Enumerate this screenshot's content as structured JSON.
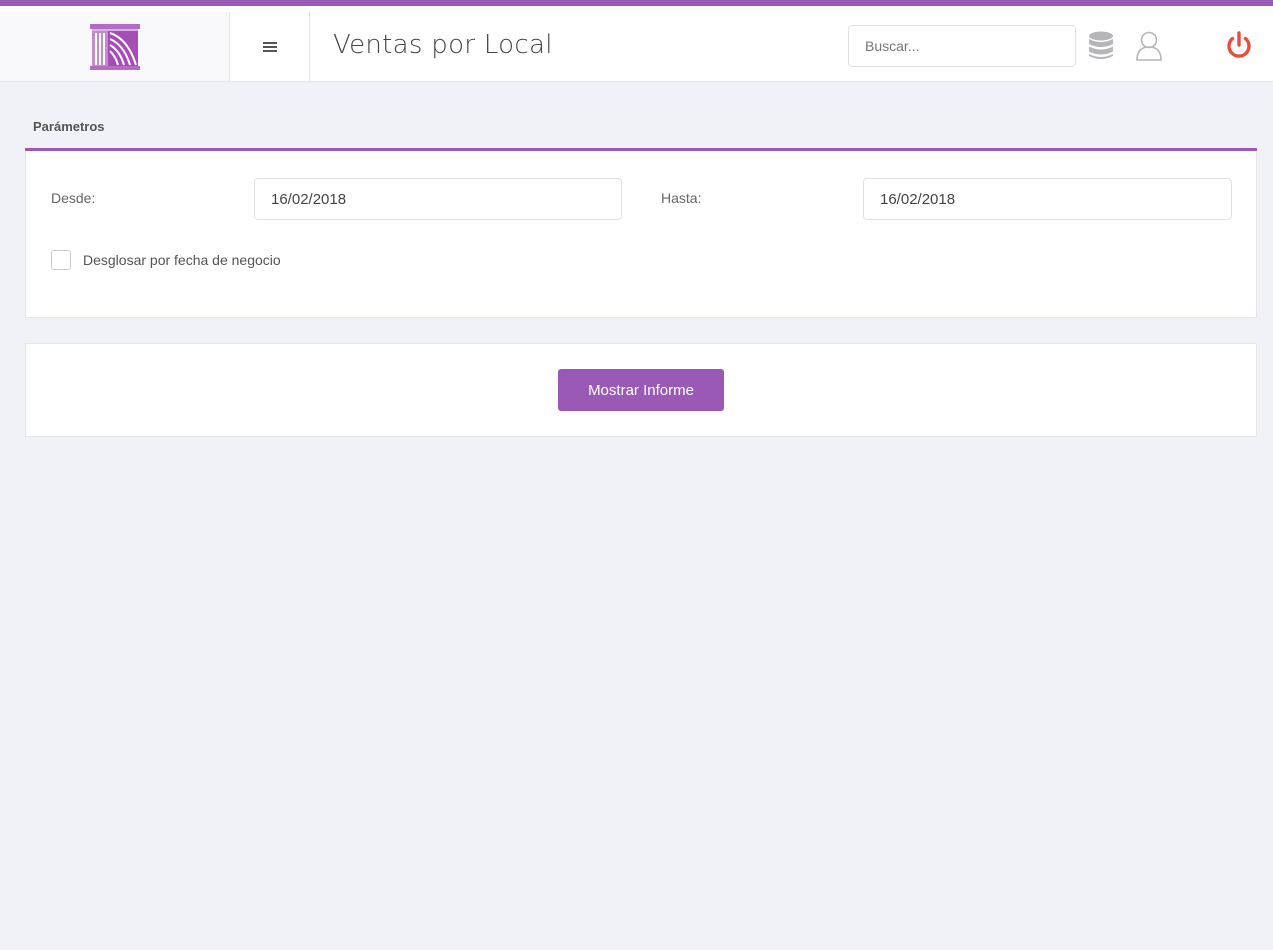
{
  "header": {
    "title": "Ventas por Local",
    "search_placeholder": "Buscar...",
    "icons": {
      "logo": "pillar-logo-icon",
      "menu": "hamburger-menu-icon",
      "database": "database-icon",
      "user": "user-icon",
      "power": "power-icon"
    }
  },
  "parameters": {
    "heading": "Parámetros",
    "from_label": "Desde:",
    "from_value": "16/02/2018",
    "to_label": "Hasta:",
    "to_value": "16/02/2018",
    "breakdown_label": "Desglosar por fecha de negocio",
    "breakdown_checked": false
  },
  "actions": {
    "show_report_label": "Mostrar Informe"
  },
  "colors": {
    "accent": "#9b59b6",
    "power": "#e74c3c",
    "background": "#f1f2f7"
  }
}
